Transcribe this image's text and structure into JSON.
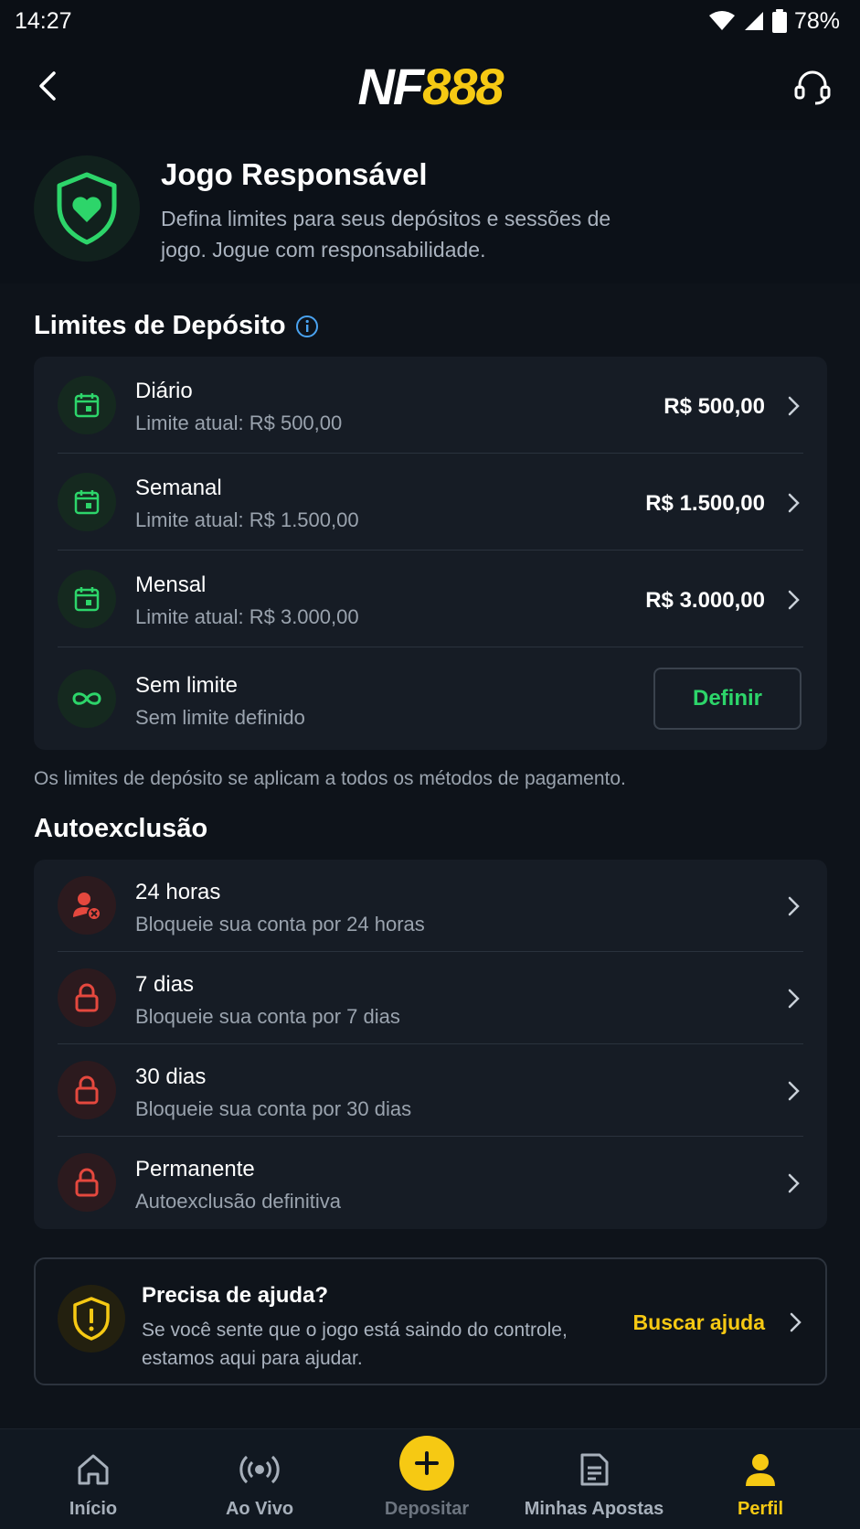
{
  "status_bar": {
    "time": "14:27",
    "battery": "78%"
  },
  "header": {
    "logo_nf": "NF",
    "logo_num": "888"
  },
  "hero": {
    "title": "Jogo Responsável",
    "description": "Defina limites para seus depósitos e sessões de jogo. Jogue com responsabilidade."
  },
  "deposit_limits": {
    "title": "Limites de Depósito",
    "items": [
      {
        "title": "Diário",
        "subtitle": "Limite atual: R$ 500,00",
        "amount": "R$ 500,00"
      },
      {
        "title": "Semanal",
        "subtitle": "Limite atual: R$ 1.500,00",
        "amount": "R$ 1.500,00"
      },
      {
        "title": "Mensal",
        "subtitle": "Limite atual: R$ 3.000,00",
        "amount": "R$ 3.000,00"
      },
      {
        "title": "Sem limite",
        "subtitle": "Sem limite definido",
        "button": "Definir"
      }
    ],
    "note": "Os limites de depósito se aplicam a todos os métodos de pagamento."
  },
  "self_exclusion": {
    "title": "Autoexclusão",
    "items": [
      {
        "title": "24 horas",
        "subtitle": "Bloqueie sua conta por 24 horas"
      },
      {
        "title": "7 dias",
        "subtitle": "Bloqueie sua conta por 7 dias"
      },
      {
        "title": "30 dias",
        "subtitle": "Bloqueie sua conta por 30 dias"
      },
      {
        "title": "Permanente",
        "subtitle": "Autoexclusão definitiva"
      }
    ]
  },
  "help": {
    "title": "Precisa de ajuda?",
    "description": "Se você sente que o jogo está saindo do controle, estamos aqui para ajudar.",
    "link": "Buscar ajuda"
  },
  "bottom_nav": {
    "items": [
      {
        "label": "Início",
        "icon": "home-icon"
      },
      {
        "label": "Ao Vivo",
        "icon": "live-icon"
      },
      {
        "label": "Depositar",
        "icon": "plus-icon"
      },
      {
        "label": "Minhas Apostas",
        "icon": "bets-icon"
      },
      {
        "label": "Perfil",
        "icon": "user-icon"
      }
    ],
    "active": "Perfil"
  },
  "colors": {
    "accent_yellow": "#f6c913",
    "accent_green": "#2dd56a",
    "accent_red": "#e5483e",
    "background": "#0e131a"
  }
}
